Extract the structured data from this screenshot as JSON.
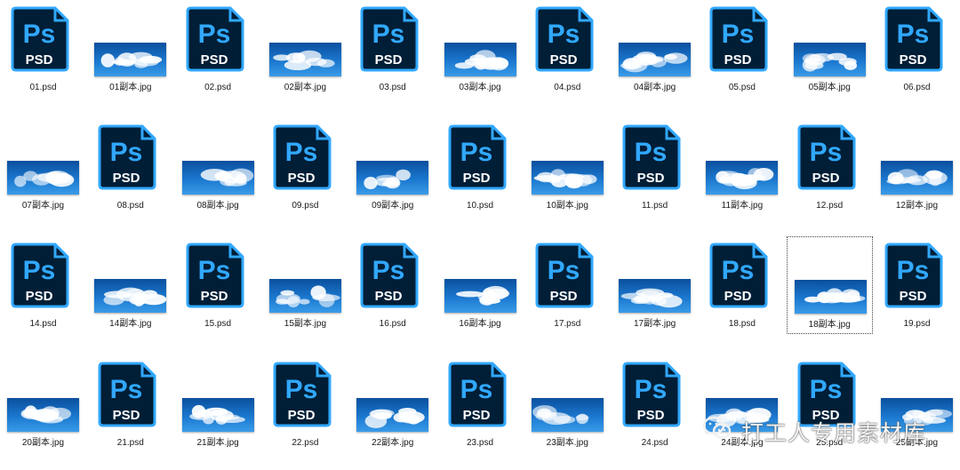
{
  "colors": {
    "psd_body": "#001e36",
    "psd_border": "#31a8ff",
    "psd_text": "#31a8ff",
    "sky_top": "#0b4f9e",
    "sky_bottom": "#3a9be8"
  },
  "icon_text": {
    "ps": "Ps",
    "psd": "PSD"
  },
  "rows": [
    {
      "items": [
        {
          "type": "psd",
          "label": "01.psd"
        },
        {
          "type": "jpg",
          "label": "01副本.jpg"
        },
        {
          "type": "psd",
          "label": "02.psd"
        },
        {
          "type": "jpg",
          "label": "02副本.jpg"
        },
        {
          "type": "psd",
          "label": "03.psd"
        },
        {
          "type": "jpg",
          "label": "03副本.jpg"
        },
        {
          "type": "psd",
          "label": "04.psd"
        },
        {
          "type": "jpg",
          "label": "04副本.jpg"
        },
        {
          "type": "psd",
          "label": "05.psd"
        },
        {
          "type": "jpg",
          "label": "05副本.jpg"
        },
        {
          "type": "psd",
          "label": "06.psd"
        }
      ]
    },
    {
      "items": [
        {
          "type": "jpg",
          "label": "07副本.jpg"
        },
        {
          "type": "psd",
          "label": "08.psd"
        },
        {
          "type": "jpg",
          "label": "08副本.jpg"
        },
        {
          "type": "psd",
          "label": "09.psd"
        },
        {
          "type": "jpg",
          "label": "09副本.jpg"
        },
        {
          "type": "psd",
          "label": "10.psd"
        },
        {
          "type": "jpg",
          "label": "10副本.jpg"
        },
        {
          "type": "psd",
          "label": "11.psd"
        },
        {
          "type": "jpg",
          "label": "11副本.jpg"
        },
        {
          "type": "psd",
          "label": "12.psd"
        },
        {
          "type": "jpg",
          "label": "12副本.jpg"
        }
      ]
    },
    {
      "items": [
        {
          "type": "psd",
          "label": "14.psd"
        },
        {
          "type": "jpg",
          "label": "14副本.jpg"
        },
        {
          "type": "psd",
          "label": "15.psd"
        },
        {
          "type": "jpg",
          "label": "15副本.jpg"
        },
        {
          "type": "psd",
          "label": "16.psd"
        },
        {
          "type": "jpg",
          "label": "16副本.jpg"
        },
        {
          "type": "psd",
          "label": "17.psd"
        },
        {
          "type": "jpg",
          "label": "17副本.jpg"
        },
        {
          "type": "psd",
          "label": "18.psd"
        },
        {
          "type": "jpg",
          "label": "18副本.jpg",
          "selected": true
        },
        {
          "type": "psd",
          "label": "19.psd"
        }
      ]
    },
    {
      "items": [
        {
          "type": "jpg",
          "label": "20副本.jpg"
        },
        {
          "type": "psd",
          "label": "21.psd"
        },
        {
          "type": "jpg",
          "label": "21副本.jpg"
        },
        {
          "type": "psd",
          "label": "22.psd"
        },
        {
          "type": "jpg",
          "label": "22副本.jpg"
        },
        {
          "type": "psd",
          "label": "23.psd"
        },
        {
          "type": "jpg",
          "label": "23副本.jpg"
        },
        {
          "type": "psd",
          "label": "24.psd"
        },
        {
          "type": "jpg",
          "label": "24副本.jpg"
        },
        {
          "type": "psd",
          "label": "25.psd"
        },
        {
          "type": "jpg",
          "label": "25副本.jpg"
        }
      ]
    }
  ],
  "watermark": {
    "text": "打工人专用素材库",
    "icon": "wechat-icon"
  }
}
